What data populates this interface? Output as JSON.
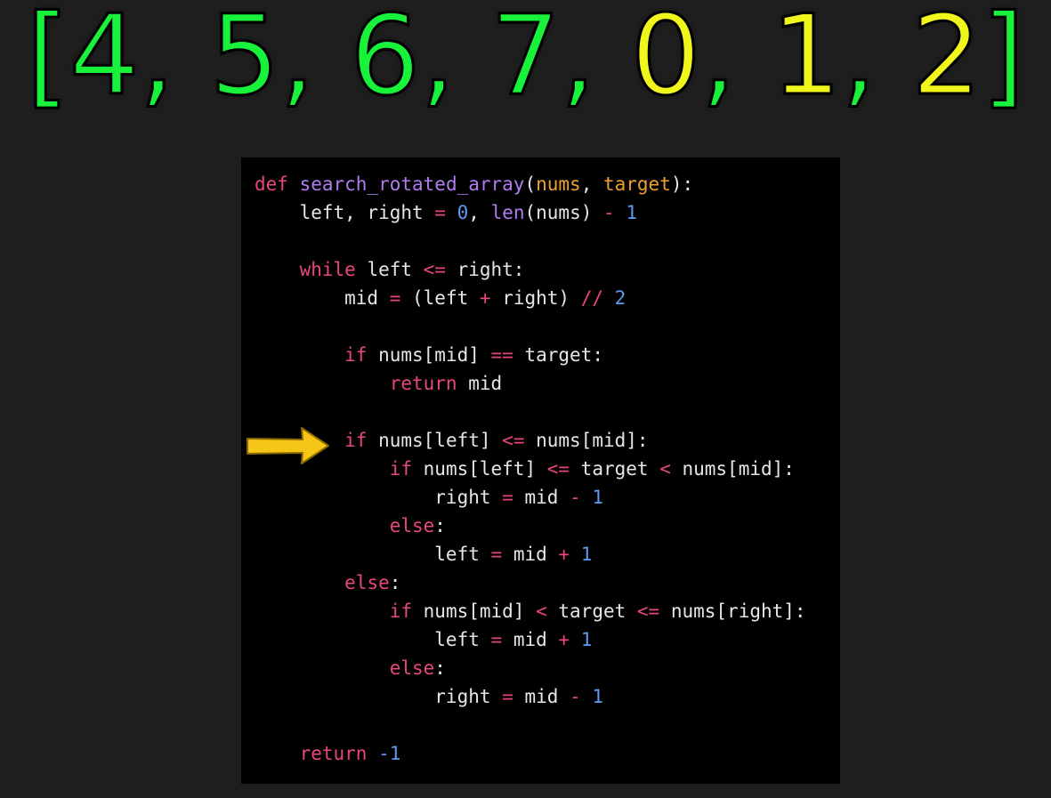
{
  "colors": {
    "background": "#1e1e1e",
    "code_background": "#000000",
    "array_green": "#19f23a",
    "array_yellow": "#f0f51c",
    "arrow": "#f5c518",
    "keyword": "#e8467c",
    "function_name": "#b07cf0",
    "parameter": "#f0a030",
    "builtin": "#b07cf0",
    "number": "#5b9bf0",
    "operator": "#e8467c",
    "text": "#e6e6e6"
  },
  "array_title": {
    "tokens": [
      {
        "text": "[",
        "color": "green"
      },
      {
        "text": "4, ",
        "color": "green"
      },
      {
        "text": "5, ",
        "color": "green"
      },
      {
        "text": "6, ",
        "color": "green"
      },
      {
        "text": "7, ",
        "color": "green"
      },
      {
        "text": "0",
        "color": "yellow"
      },
      {
        "text": ", ",
        "color": "green"
      },
      {
        "text": "1",
        "color": "yellow"
      },
      {
        "text": ", ",
        "color": "green"
      },
      {
        "text": "2",
        "color": "yellow"
      },
      {
        "text": "]",
        "color": "green"
      }
    ]
  },
  "arrow_icon": "arrow-right-icon",
  "code_lines": [
    [
      {
        "t": "def ",
        "c": "keyword"
      },
      {
        "t": "search_rotated_array",
        "c": "function_name"
      },
      {
        "t": "(",
        "c": "text"
      },
      {
        "t": "nums",
        "c": "parameter"
      },
      {
        "t": ", ",
        "c": "text"
      },
      {
        "t": "target",
        "c": "parameter"
      },
      {
        "t": "):",
        "c": "text"
      }
    ],
    [
      {
        "t": "    left, right ",
        "c": "text"
      },
      {
        "t": "=",
        "c": "operator"
      },
      {
        "t": " ",
        "c": "text"
      },
      {
        "t": "0",
        "c": "number"
      },
      {
        "t": ", ",
        "c": "text"
      },
      {
        "t": "len",
        "c": "builtin"
      },
      {
        "t": "(nums) ",
        "c": "text"
      },
      {
        "t": "-",
        "c": "operator"
      },
      {
        "t": " ",
        "c": "text"
      },
      {
        "t": "1",
        "c": "number"
      }
    ],
    [],
    [
      {
        "t": "    ",
        "c": "text"
      },
      {
        "t": "while",
        "c": "keyword"
      },
      {
        "t": " left ",
        "c": "text"
      },
      {
        "t": "<=",
        "c": "operator"
      },
      {
        "t": " right:",
        "c": "text"
      }
    ],
    [
      {
        "t": "        mid ",
        "c": "text"
      },
      {
        "t": "=",
        "c": "operator"
      },
      {
        "t": " (left ",
        "c": "text"
      },
      {
        "t": "+",
        "c": "operator"
      },
      {
        "t": " right) ",
        "c": "text"
      },
      {
        "t": "//",
        "c": "operator"
      },
      {
        "t": " ",
        "c": "text"
      },
      {
        "t": "2",
        "c": "number"
      }
    ],
    [],
    [
      {
        "t": "        ",
        "c": "text"
      },
      {
        "t": "if",
        "c": "keyword"
      },
      {
        "t": " nums[mid] ",
        "c": "text"
      },
      {
        "t": "==",
        "c": "operator"
      },
      {
        "t": " target:",
        "c": "text"
      }
    ],
    [
      {
        "t": "            ",
        "c": "text"
      },
      {
        "t": "return",
        "c": "keyword"
      },
      {
        "t": " mid",
        "c": "text"
      }
    ],
    [],
    [
      {
        "t": "        ",
        "c": "text"
      },
      {
        "t": "if",
        "c": "keyword"
      },
      {
        "t": " nums[left] ",
        "c": "text"
      },
      {
        "t": "<=",
        "c": "operator"
      },
      {
        "t": " nums[mid]:",
        "c": "text"
      }
    ],
    [
      {
        "t": "            ",
        "c": "text"
      },
      {
        "t": "if",
        "c": "keyword"
      },
      {
        "t": " nums[left] ",
        "c": "text"
      },
      {
        "t": "<=",
        "c": "operator"
      },
      {
        "t": " target ",
        "c": "text"
      },
      {
        "t": "<",
        "c": "operator"
      },
      {
        "t": " nums[mid]:",
        "c": "text"
      }
    ],
    [
      {
        "t": "                right ",
        "c": "text"
      },
      {
        "t": "=",
        "c": "operator"
      },
      {
        "t": " mid ",
        "c": "text"
      },
      {
        "t": "-",
        "c": "operator"
      },
      {
        "t": " ",
        "c": "text"
      },
      {
        "t": "1",
        "c": "number"
      }
    ],
    [
      {
        "t": "            ",
        "c": "text"
      },
      {
        "t": "else",
        "c": "keyword"
      },
      {
        "t": ":",
        "c": "text"
      }
    ],
    [
      {
        "t": "                left ",
        "c": "text"
      },
      {
        "t": "=",
        "c": "operator"
      },
      {
        "t": " mid ",
        "c": "text"
      },
      {
        "t": "+",
        "c": "operator"
      },
      {
        "t": " ",
        "c": "text"
      },
      {
        "t": "1",
        "c": "number"
      }
    ],
    [
      {
        "t": "        ",
        "c": "text"
      },
      {
        "t": "else",
        "c": "keyword"
      },
      {
        "t": ":",
        "c": "text"
      }
    ],
    [
      {
        "t": "            ",
        "c": "text"
      },
      {
        "t": "if",
        "c": "keyword"
      },
      {
        "t": " nums[mid] ",
        "c": "text"
      },
      {
        "t": "<",
        "c": "operator"
      },
      {
        "t": " target ",
        "c": "text"
      },
      {
        "t": "<=",
        "c": "operator"
      },
      {
        "t": " nums[right]:",
        "c": "text"
      }
    ],
    [
      {
        "t": "                left ",
        "c": "text"
      },
      {
        "t": "=",
        "c": "operator"
      },
      {
        "t": " mid ",
        "c": "text"
      },
      {
        "t": "+",
        "c": "operator"
      },
      {
        "t": " ",
        "c": "text"
      },
      {
        "t": "1",
        "c": "number"
      }
    ],
    [
      {
        "t": "            ",
        "c": "text"
      },
      {
        "t": "else",
        "c": "keyword"
      },
      {
        "t": ":",
        "c": "text"
      }
    ],
    [
      {
        "t": "                right ",
        "c": "text"
      },
      {
        "t": "=",
        "c": "operator"
      },
      {
        "t": " mid ",
        "c": "text"
      },
      {
        "t": "-",
        "c": "operator"
      },
      {
        "t": " ",
        "c": "text"
      },
      {
        "t": "1",
        "c": "number"
      }
    ],
    [],
    [
      {
        "t": "    ",
        "c": "text"
      },
      {
        "t": "return",
        "c": "keyword"
      },
      {
        "t": " ",
        "c": "text"
      },
      {
        "t": "-1",
        "c": "number"
      }
    ]
  ]
}
